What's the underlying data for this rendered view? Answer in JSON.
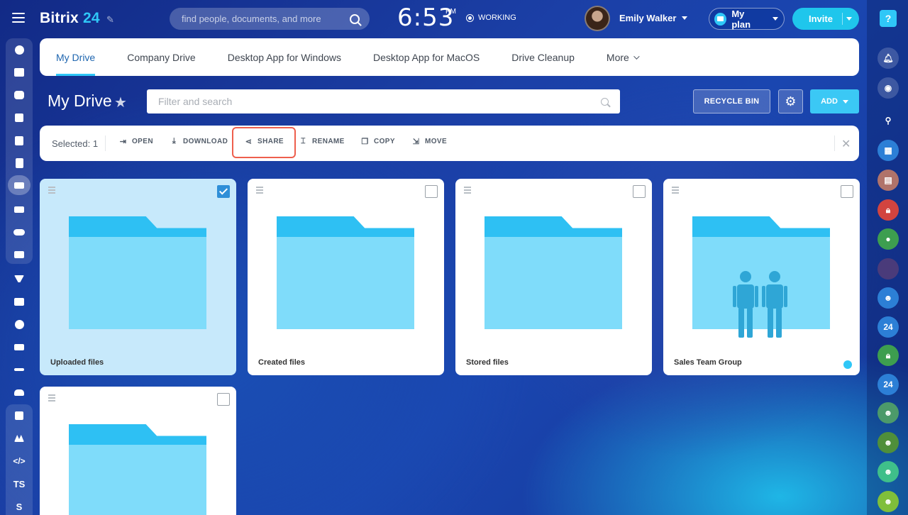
{
  "app": {
    "logo_main": "Bitrix",
    "logo_num": "24"
  },
  "header": {
    "search_placeholder": "find people, documents, and more",
    "time": "6:53",
    "ampm": "PM",
    "status": "WORKING",
    "user_name": "Emily Walker",
    "plan_label": "My plan",
    "invite_label": "Invite"
  },
  "tabs": [
    {
      "label": "My Drive",
      "active": true
    },
    {
      "label": "Company Drive"
    },
    {
      "label": "Desktop App for Windows"
    },
    {
      "label": "Desktop App for MacOS"
    },
    {
      "label": "Drive Cleanup"
    },
    {
      "label": "More"
    }
  ],
  "toolbar": {
    "title": "My Drive",
    "filter_placeholder": "Filter and search",
    "recycle_label": "RECYCLE BIN",
    "add_label": "ADD"
  },
  "actions": {
    "selected": "Selected: 1",
    "open": "OPEN",
    "download": "DOWNLOAD",
    "share": "SHARE",
    "rename": "RENAME",
    "copy": "COPY",
    "move": "MOVE"
  },
  "folders": [
    {
      "name": "Uploaded files",
      "selected": true
    },
    {
      "name": "Created files",
      "selected": false
    },
    {
      "name": "Stored files",
      "selected": false
    },
    {
      "name": "Sales Team Group",
      "selected": false,
      "group": true
    },
    {
      "name": "",
      "selected": false
    }
  ],
  "left_nav_text": {
    "ts": "TS",
    "s": "S"
  },
  "right_nav_text": {
    "b24a": "24",
    "b24b": "24"
  },
  "colors": {
    "accent": "#2fc7f7",
    "highlight": "#ee5f4d",
    "folder_front": "#7fdcfa",
    "folder_back": "#2ec0f3"
  }
}
